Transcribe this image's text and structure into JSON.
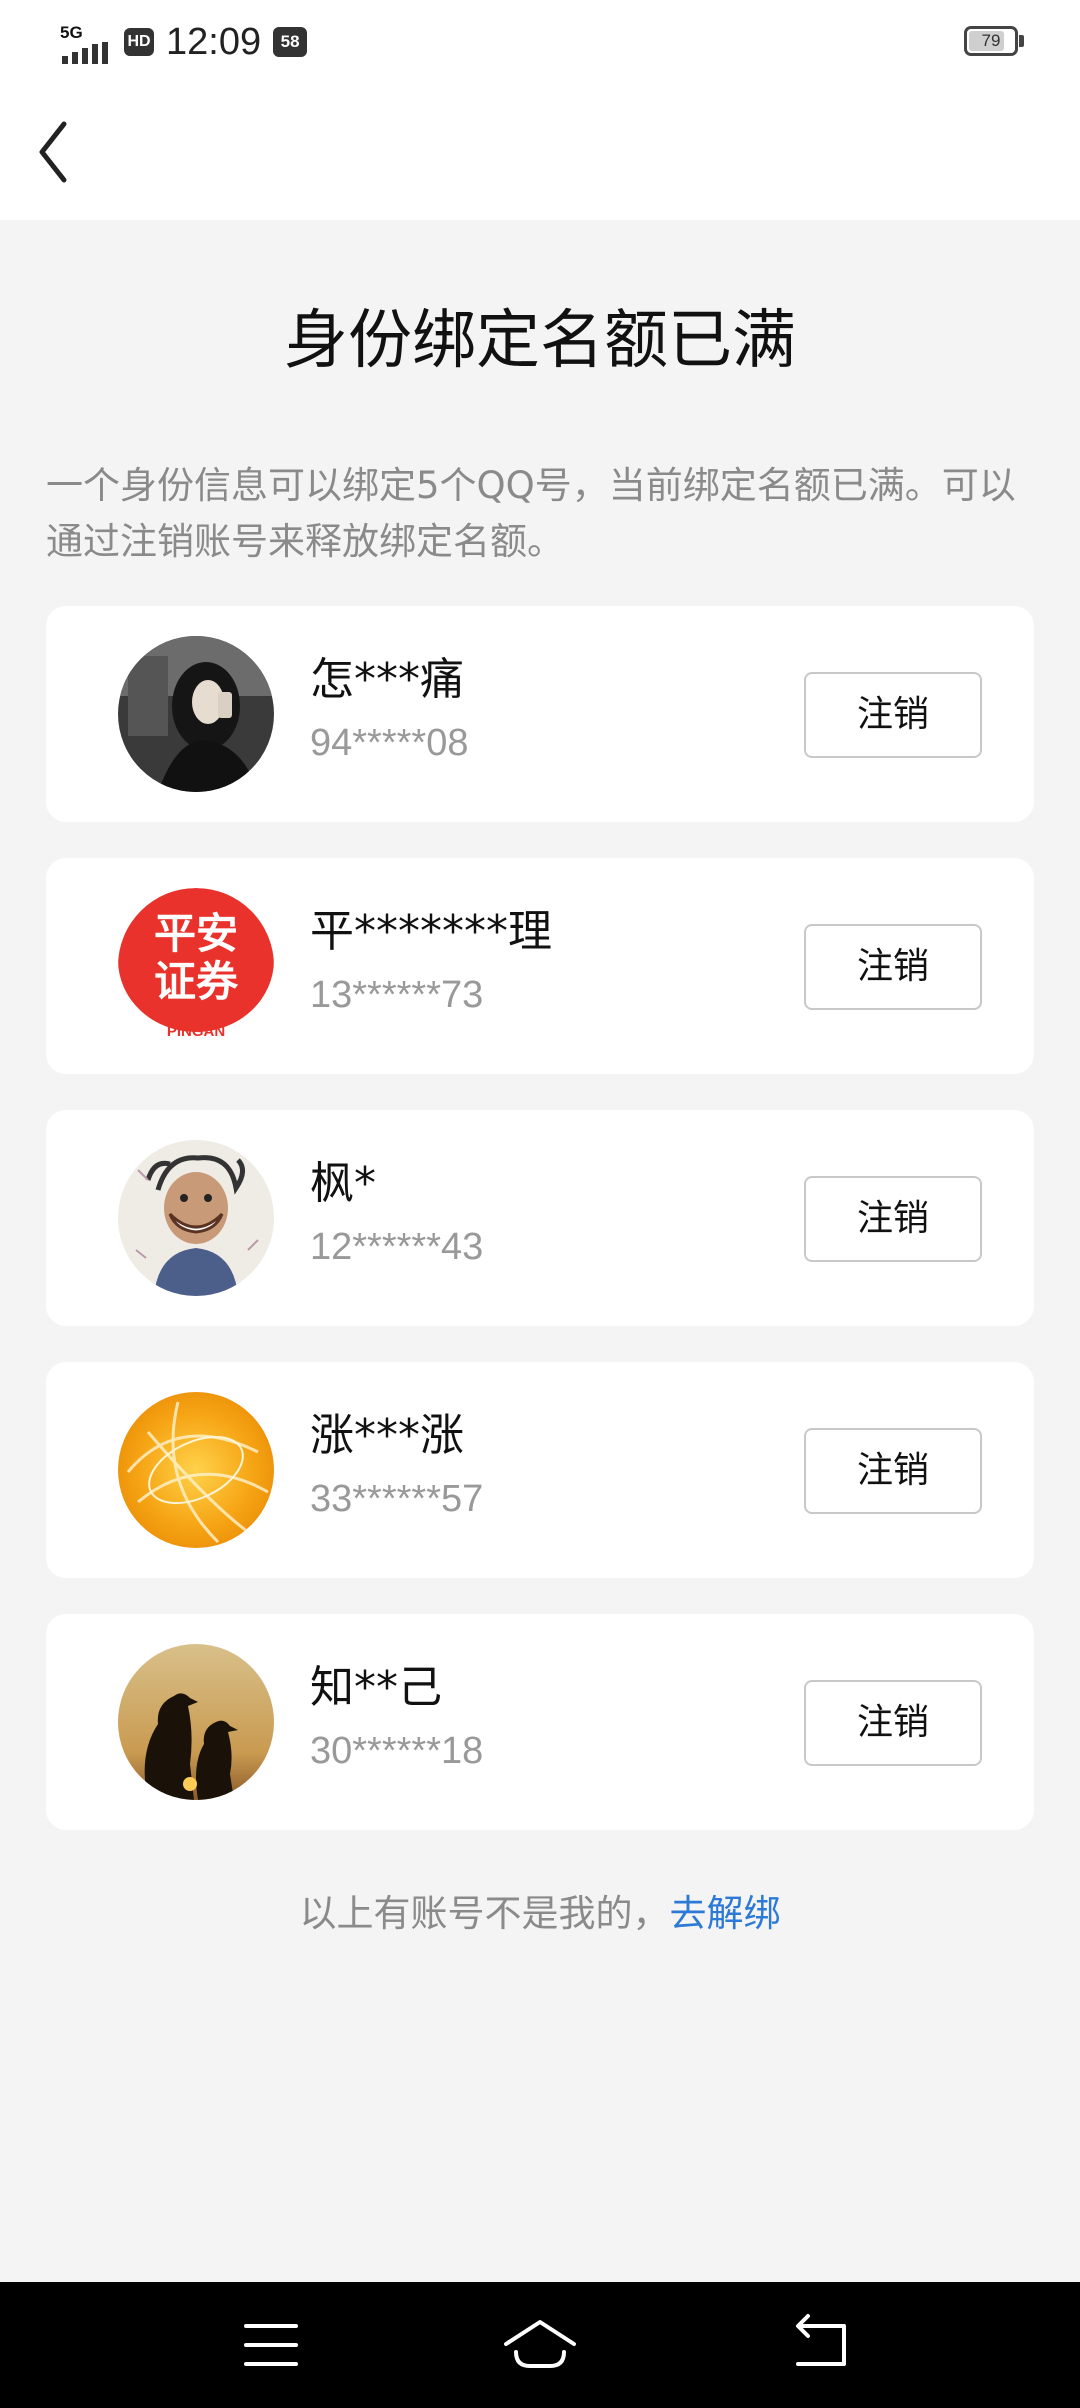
{
  "status_bar": {
    "network": "5G",
    "hd": "HD",
    "time": "12:09",
    "badge": "58",
    "battery": "79",
    "battery_level": 0.79
  },
  "header": {
    "back_icon": "chevron-left-icon"
  },
  "title": "身份绑定名额已满",
  "description": "一个身份信息可以绑定5个QQ号，当前绑定名额已满。可以通过注销账号来释放绑定名额。",
  "accounts": [
    {
      "name": "怎***痛",
      "number": "94*****08",
      "action": "注销"
    },
    {
      "name": "平*******理",
      "number": "13******73",
      "action": "注销",
      "avatar_text": "平安证券",
      "avatar_subtext": "PINGAN"
    },
    {
      "name": "枫*",
      "number": "12******43",
      "action": "注销"
    },
    {
      "name": "涨***涨",
      "number": "33******57",
      "action": "注销"
    },
    {
      "name": "知**己",
      "number": "30******18",
      "action": "注销"
    }
  ],
  "footer": {
    "text": "以上有账号不是我的，",
    "link": "去解绑"
  },
  "colors": {
    "link": "#2d7ad6",
    "background": "#f4f4f4",
    "card": "#ffffff",
    "muted_text": "#8a8a8a"
  },
  "system_nav": {
    "menu_icon": "menu-icon",
    "home_icon": "home-icon",
    "back_icon": "back-arrow-icon"
  }
}
